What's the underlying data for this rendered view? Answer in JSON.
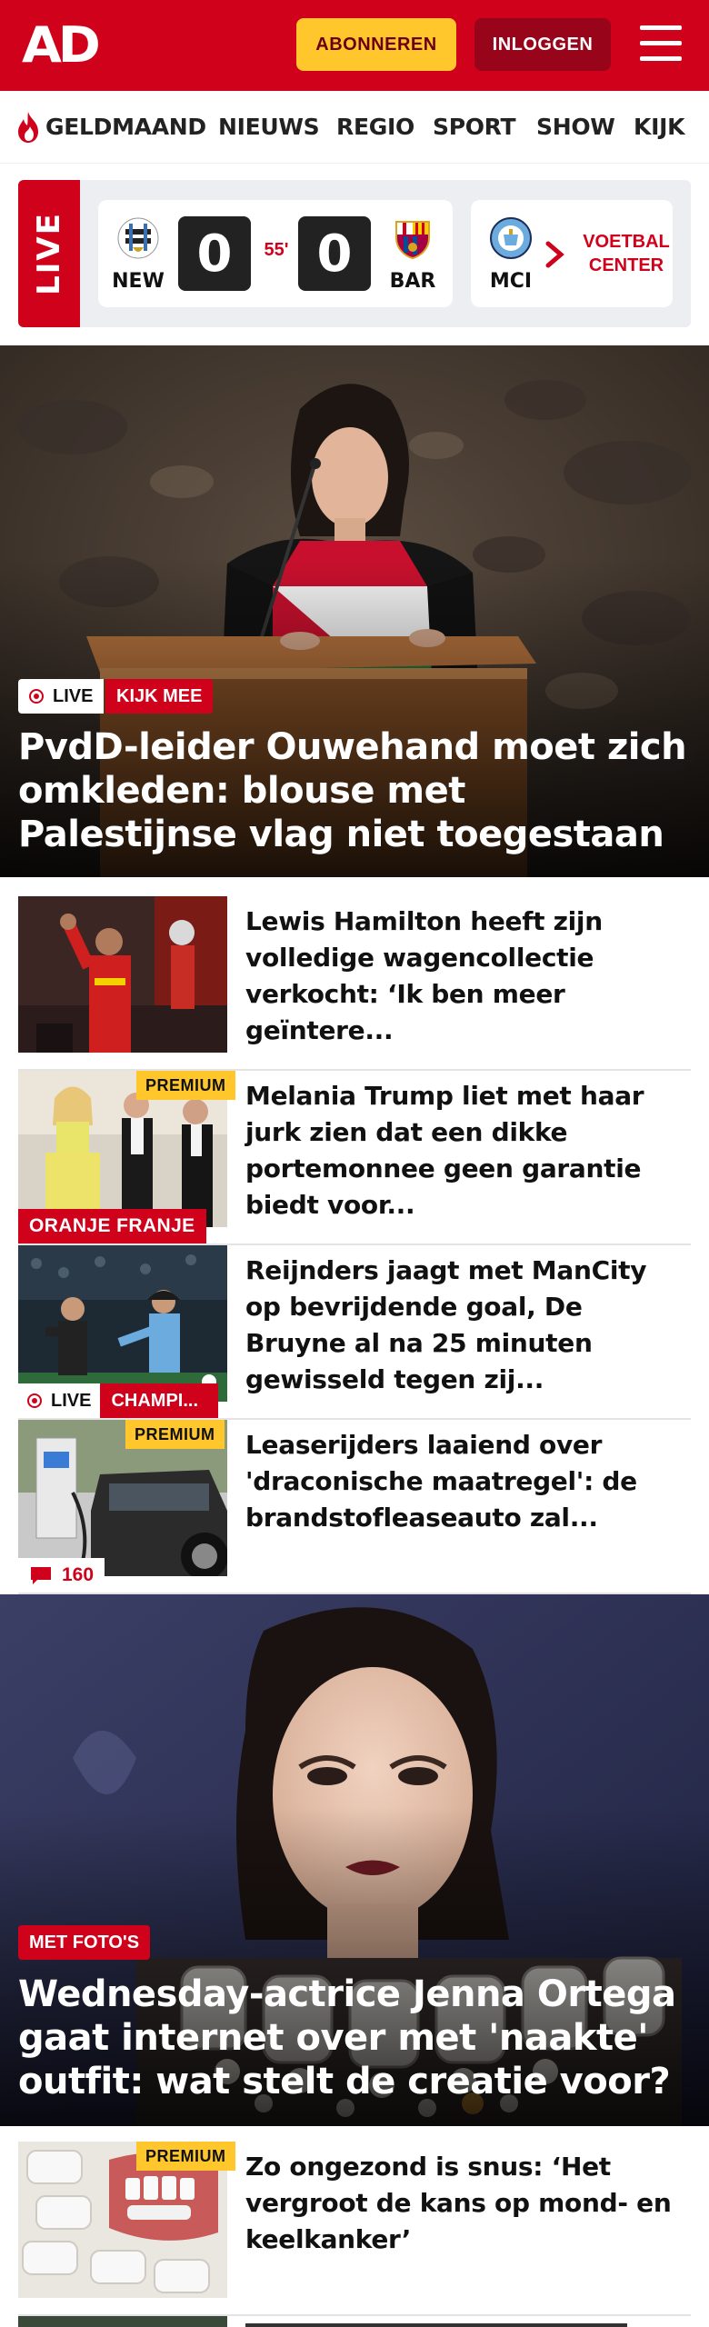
{
  "header": {
    "logo": "AD",
    "subscribe_label": "ABONNEREN",
    "login_label": "INLOGGEN",
    "menu_icon": "hamburger-menu-icon",
    "brand_color": "#d0021b"
  },
  "nav": {
    "items": [
      {
        "label": "GELDMAAND",
        "icon": "flame-icon"
      },
      {
        "label": "NIEUWS"
      },
      {
        "label": "REGIO"
      },
      {
        "label": "SPORT"
      },
      {
        "label": "SHOW"
      },
      {
        "label": "KIJK"
      }
    ]
  },
  "live_scores": {
    "live_label": "LIVE",
    "match": {
      "home_code": "NEW",
      "home_score": "0",
      "minute": "55'",
      "away_score": "0",
      "away_code": "BAR"
    },
    "second_match": {
      "home_code": "MCI"
    },
    "voetbal_center_line1": "VOETBAL",
    "voetbal_center_line2": "CENTER"
  },
  "hero1": {
    "live_label": "LIVE",
    "cta_label": "KIJK MEE",
    "title": "PvdD-leider Ouwehand moet zich omkleden: blouse met Palestijnse vlag niet toegestaan"
  },
  "articles": [
    {
      "title": "Lewis Hamilton heeft zijn volledige wagencollectie verkocht: ‘Ik ben meer geïntere..."
    },
    {
      "title": "Melania Trump liet met haar jurk zien dat een dikke portemonnee geen garantie biedt voor...",
      "premium_label": "PREMIUM",
      "category": "ORANJE FRANJE"
    },
    {
      "title": "Reijnders jaagt met ManCity op bevrijdende goal, De Bruyne al na 25 minuten gewisseld tegen zij...",
      "live_label": "LIVE",
      "category": "CHAMPI..."
    },
    {
      "title": "Leaserijders laaiend over 'draconische maatregel': de brandstofleaseauto zal...",
      "premium_label": "PREMIUM",
      "comments": "160"
    }
  ],
  "hero2": {
    "badge": "MET FOTO'S",
    "title": "Wednesday-actrice Jenna Ortega gaat internet over met 'naakte' outfit: wat stelt de creatie voor?"
  },
  "articles2": [
    {
      "title": "Zo ongezond is snus: ‘Het vergroot de kans op mond- en keelkanker’",
      "premium_label": "PREMIUM"
    }
  ]
}
